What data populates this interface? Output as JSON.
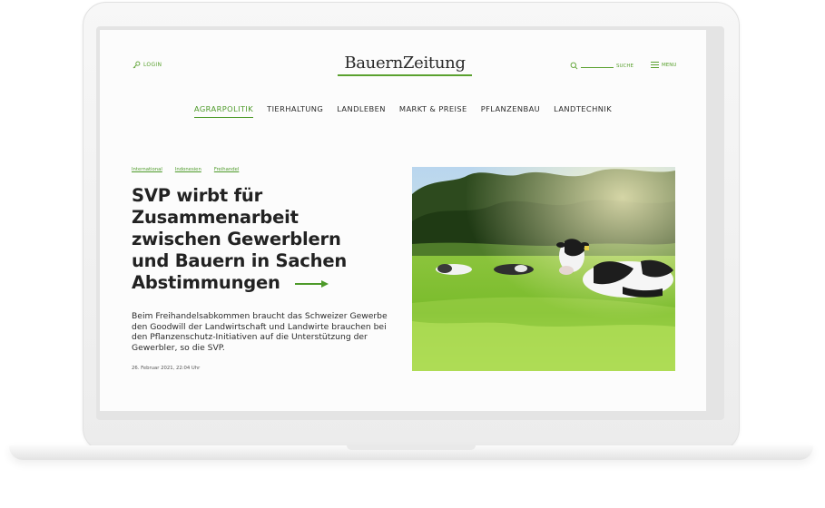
{
  "site": {
    "logo": "BauernZeitung",
    "login_label": "LOGIN",
    "search_label": "SUCHE",
    "menu_label": "MENU"
  },
  "nav": {
    "items": [
      {
        "label": "AGRARPOLITIK",
        "active": true
      },
      {
        "label": "TIERHALTUNG",
        "active": false
      },
      {
        "label": "LANDLEBEN",
        "active": false
      },
      {
        "label": "MARKT & PREISE",
        "active": false
      },
      {
        "label": "PFLANZENBAU",
        "active": false
      },
      {
        "label": "LANDTECHNIK",
        "active": false
      }
    ]
  },
  "article": {
    "tags": [
      "International",
      "Indonesien",
      "Freihandel"
    ],
    "headline": "SVP wirbt für Zusammenarbeit zwischen Gewerblern und Bauern in Sachen Abstimmungen",
    "lead": "Beim Freihandelsabkommen braucht das Schweizer Gewerbe den Goodwill der Landwirtschaft und Landwirte brauchen bei den Pflanzenschutz-Initiativen auf die Unterstützung der Gewerbler, so die SVP.",
    "date": "26. Februar 2021, 22:04 Uhr"
  },
  "colors": {
    "accent": "#4d9a29",
    "text": "#222222"
  }
}
